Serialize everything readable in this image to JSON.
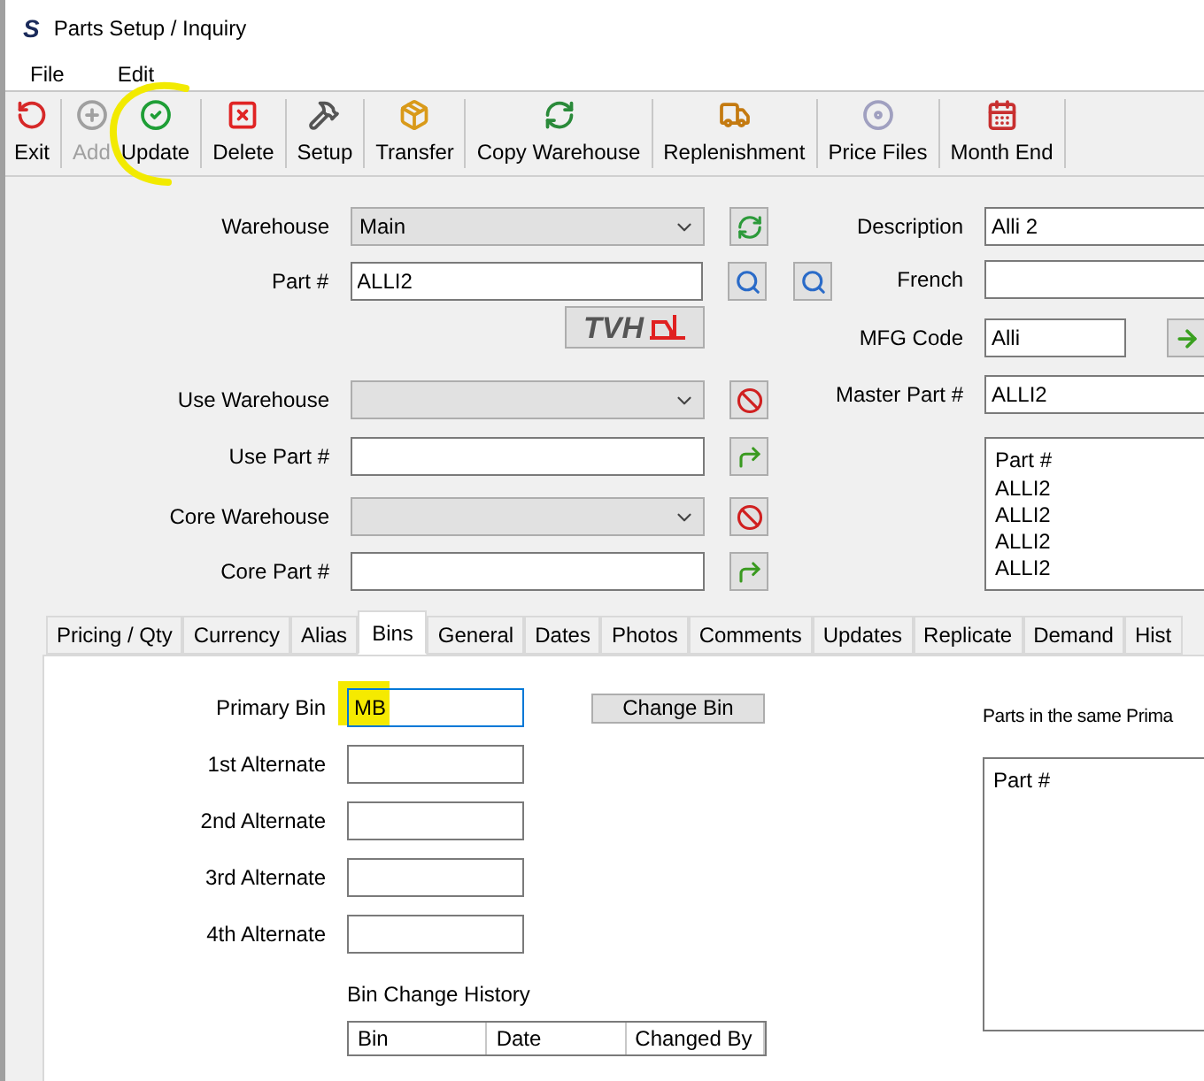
{
  "window": {
    "title": "Parts Setup / Inquiry",
    "logo": "S"
  },
  "menu": [
    "File",
    "Edit"
  ],
  "toolbar": [
    {
      "label": "Exit",
      "disabled": false
    },
    {
      "label": "Add",
      "disabled": true
    },
    {
      "label": "Update",
      "disabled": false
    },
    {
      "label": "Delete",
      "disabled": false
    },
    {
      "label": "Setup",
      "disabled": false
    },
    {
      "label": "Transfer",
      "disabled": false
    },
    {
      "label": "Copy Warehouse",
      "disabled": false
    },
    {
      "label": "Replenishment",
      "disabled": false
    },
    {
      "label": "Price Files",
      "disabled": false
    },
    {
      "label": "Month End",
      "disabled": false
    }
  ],
  "left_fields": [
    {
      "kind": "select",
      "label": "Warehouse",
      "value": "Main"
    },
    {
      "kind": "text",
      "label": "Part #",
      "value": "ALLI2"
    },
    {
      "kind": "logo",
      "text": "TVH"
    },
    {
      "kind": "select",
      "label": "Use Warehouse"
    },
    {
      "kind": "text",
      "label": "Use Part #"
    },
    {
      "kind": "select",
      "label": "Core Warehouse"
    },
    {
      "kind": "text",
      "label": "Core Part #"
    }
  ],
  "right_fields": [
    {
      "kind": "text",
      "label": "Description",
      "value": "Alli 2"
    },
    {
      "kind": "text",
      "label": "French"
    },
    {
      "kind": "short",
      "label": "MFG Code",
      "value": "Alli"
    },
    {
      "kind": "text",
      "label": "Master Part #",
      "value": "ALLI2"
    }
  ],
  "part_list": {
    "header": "Part #",
    "items": [
      "ALLI2",
      "ALLI2",
      "ALLI2",
      "ALLI2"
    ]
  },
  "tabs": [
    {
      "label": "Pricing / Qty",
      "selected": false
    },
    {
      "label": "Currency",
      "selected": false
    },
    {
      "label": "Alias",
      "selected": false
    },
    {
      "label": "Bins",
      "selected": true
    },
    {
      "label": "General",
      "selected": false
    },
    {
      "label": "Dates",
      "selected": false
    },
    {
      "label": "Photos",
      "selected": false
    },
    {
      "label": "Comments",
      "selected": false
    },
    {
      "label": "Updates",
      "selected": false
    },
    {
      "label": "Replicate",
      "selected": false
    },
    {
      "label": "Demand",
      "selected": false
    },
    {
      "label": "Hist",
      "selected": false
    }
  ],
  "bins": {
    "fields": [
      {
        "label": "Primary Bin",
        "value": "MB",
        "focused": true
      },
      {
        "label": "1st Alternate",
        "focused": false
      },
      {
        "label": "2nd Alternate",
        "focused": false
      },
      {
        "label": "3rd Alternate",
        "focused": false
      },
      {
        "label": "4th Alternate",
        "focused": false
      }
    ],
    "change_button": "Change Bin",
    "history_title": "Bin Change History",
    "history_columns": [
      "Bin",
      "Date",
      "Changed By"
    ],
    "same_bin_title": "Parts in the same Prima",
    "same_bin_header": "Part #"
  }
}
